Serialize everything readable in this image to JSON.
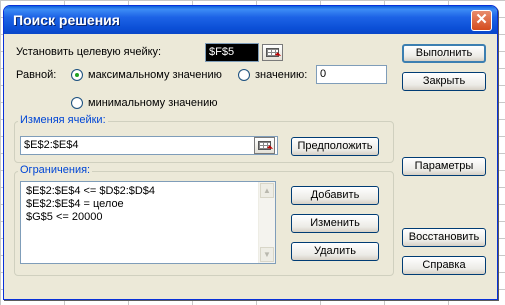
{
  "window": {
    "title": "Поиск решения",
    "close_glyph": "✕"
  },
  "target": {
    "label": "Установить целевую ячейку:",
    "value": "$F$5",
    "equal_label": "Равной:",
    "opt_max": "максимальному значению",
    "opt_value": "значению:",
    "value_input": "0",
    "opt_min": "минимальному значению",
    "selected": "max"
  },
  "changing": {
    "label": "Изменяя ячейки:",
    "value": "$E$2:$E$4",
    "guess_button": "Предположить"
  },
  "constraints": {
    "label": "Ограничения:",
    "items": [
      "$E$2:$E$4 <= $D$2:$D$4",
      "$E$2:$E$4 = целое",
      "$G$5 <= 20000"
    ],
    "add_button": "Добавить",
    "change_button": "Изменить",
    "delete_button": "Удалить"
  },
  "buttons": {
    "run": "Выполнить",
    "close": "Закрыть",
    "options": "Параметры",
    "reset": "Восстановить",
    "help": "Справка"
  },
  "icons": {
    "ref": "range-select-icon",
    "scroll_up": "scroll-up-arrow-icon",
    "scroll_down": "scroll-down-arrow-icon"
  },
  "colors": {
    "title_bar": "#0a4fd6",
    "dialog_bg": "#ece9d8",
    "close_button": "#d44b1e",
    "radio_checked": "#21a121",
    "group_title": "#0046d5"
  }
}
